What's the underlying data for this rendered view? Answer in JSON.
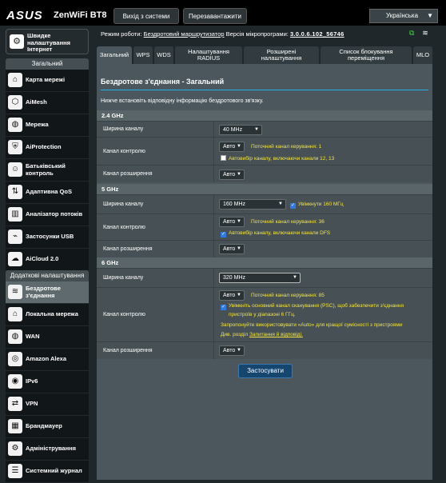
{
  "header": {
    "logo": "ASUS",
    "product": "ZenWiFi BT8",
    "logout_label": "Вихід з системи",
    "reboot_label": "Перезавантажити",
    "language": "Українська"
  },
  "status": {
    "mode_label": "Режим роботи:",
    "mode_value": "Бездротовий маршрутизатор",
    "firmware_label": "Версія мікропрограми:",
    "firmware_value": "3.0.0.6.102_56746"
  },
  "sidebar": {
    "quick_setup": "Швидке налаштування Інтернет",
    "general_header": "Загальний",
    "general_items": [
      {
        "label": "Карта мережі"
      },
      {
        "label": "AiMesh"
      },
      {
        "label": "Мережа"
      },
      {
        "label": "AiProtection"
      },
      {
        "label": "Батьківський контроль"
      },
      {
        "label": "Адаптивна QoS"
      },
      {
        "label": "Аналізатор потоків"
      },
      {
        "label": "Застосунки USB"
      },
      {
        "label": "AiCloud 2.0"
      }
    ],
    "advanced_header": "Додаткові налаштування",
    "advanced_items": [
      {
        "label": "Бездротове з'єднання"
      },
      {
        "label": "Локальна мережа"
      },
      {
        "label": "WAN"
      },
      {
        "label": "Amazon Alexa"
      },
      {
        "label": "IPv6"
      },
      {
        "label": "VPN"
      },
      {
        "label": "Брандмауер"
      },
      {
        "label": "Адміністрування"
      },
      {
        "label": "Системний журнал"
      }
    ]
  },
  "tabs": [
    {
      "label": "Загальний"
    },
    {
      "label": "WPS"
    },
    {
      "label": "WDS"
    },
    {
      "label": "Налаштування RADIUS"
    },
    {
      "label": "Розширені налаштування"
    },
    {
      "label": "Список блокування переміщення"
    },
    {
      "label": "MLO"
    }
  ],
  "page": {
    "title": "Бездротове з'єднання - Загальний",
    "description": "Нижче встановіть відповідну інформацію бездротового зв'язку.",
    "apply_label": "Застосувати"
  },
  "band24": {
    "header": "2.4 GHz",
    "bw_label": "Ширина каналу",
    "bw_value": "40 MHz",
    "ctrl_label": "Канал контролю",
    "ctrl_value": "Авто",
    "ctrl_note": "Поточний канал керування: 1",
    "ctrl_check": "Автовибір каналу, включаючи канали 12, 13",
    "ext_label": "Канал розширення",
    "ext_value": "Авто"
  },
  "band5": {
    "header": "5 GHz",
    "bw_label": "Ширина каналу",
    "bw_value": "160 MHz",
    "bw_check": "Увімкнути 160 МГц",
    "ctrl_label": "Канал контролю",
    "ctrl_value": "Авто",
    "ctrl_note": "Поточний канал керування: 36",
    "ctrl_check": "Автовибір каналу, включаючи канали DFS",
    "ext_label": "Канал розширення",
    "ext_value": "Авто"
  },
  "band6": {
    "header": "6 GHz",
    "bw_label": "Ширина каналу",
    "bw_value": "320 MHz",
    "ctrl_label": "Канал контролю",
    "ctrl_value": "Авто",
    "ctrl_note": "Поточний канал керування: 85",
    "psc_check_1": "Увімкніть основний канал сканування (PSC), щоб забезпечити з'єднання",
    "psc_check_2": "пристроїв у діапазоні 6 ГГц.",
    "auto_note": "Запропонуйте використовувати «Auto» для кращої сумісності з пристроями",
    "faq_prefix": "Див. розділ",
    "faq_link": "Запитання й відповіді.",
    "ext_label": "Канал розширення",
    "ext_value": "Авто"
  },
  "colors": {
    "accent": "#26b0e8",
    "note": "#f2e33c",
    "panel": "#4b575c",
    "status_green": "#43d440"
  }
}
